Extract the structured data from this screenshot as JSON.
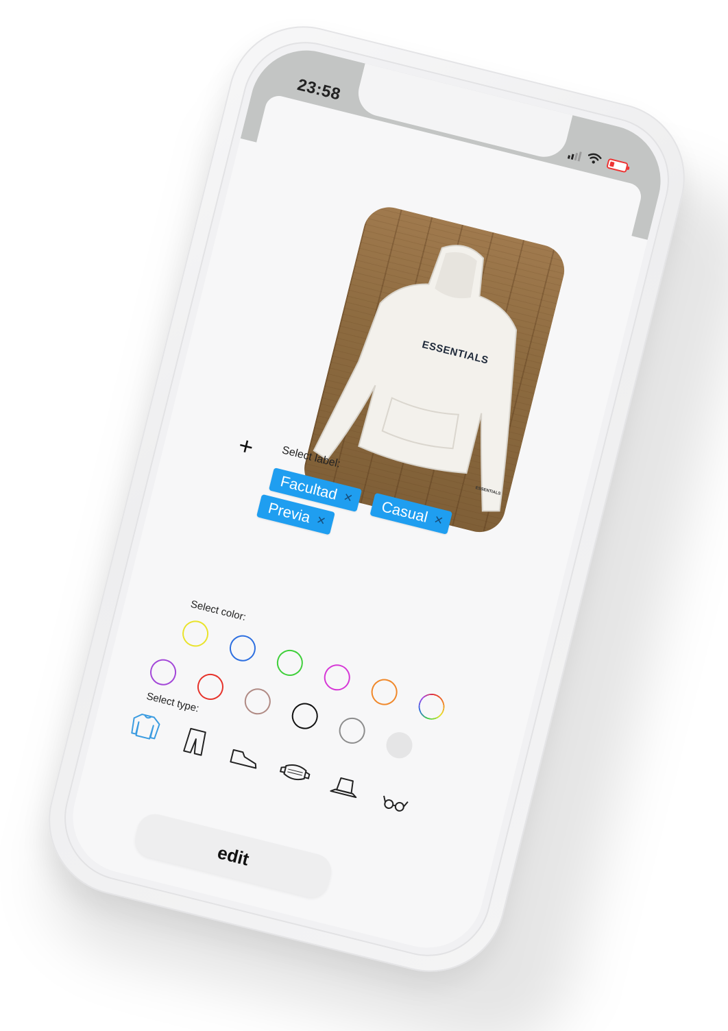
{
  "status_bar": {
    "time": "23:58",
    "battery_color": "#e33333"
  },
  "item": {
    "image_alt": "White hoodie photo",
    "brand_text": "ESSENTIALS",
    "brand_text_small": "ESSENTIALS"
  },
  "labels": {
    "add_icon": "plus-icon",
    "title": "Select label:",
    "chips": [
      {
        "label": "Facultad",
        "remove": "✕"
      },
      {
        "label": "Casual",
        "remove": "✕"
      },
      {
        "label": "Previa",
        "remove": "✕"
      }
    ]
  },
  "colors": {
    "title": "Select color:",
    "swatches": [
      "#e9e32a",
      "#2d6fe0",
      "#3fcf3a",
      "#d637d6",
      "#f0882a",
      "#a347e6",
      "#a347d8",
      "#e6332b",
      "#b08a84",
      "#111111",
      "#8c8c8c",
      "#e5e5e6"
    ]
  },
  "types": {
    "title": "Select type:",
    "items": [
      "sweater-icon",
      "pants-icon",
      "shoe-icon",
      "mask-icon",
      "hat-icon",
      "glasses-icon"
    ],
    "selected": "sweater-icon",
    "selected_color": "#3a9be0"
  },
  "actions": {
    "edit_label": "edit"
  }
}
